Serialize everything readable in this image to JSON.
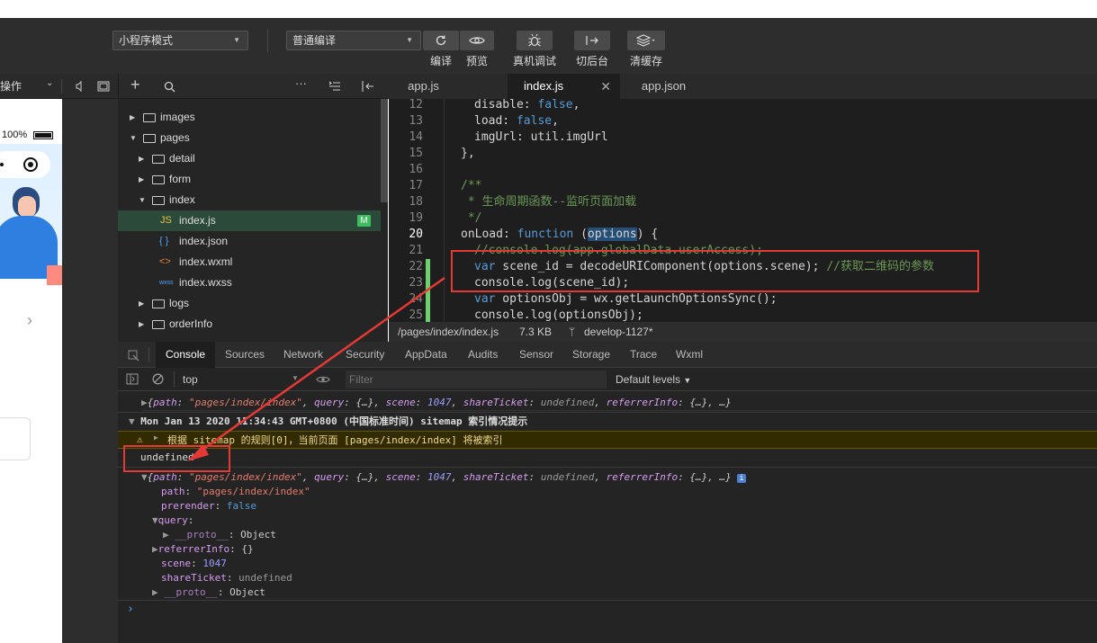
{
  "toolbar": {
    "mode_select": "小程序模式",
    "compile_select": "普通编译",
    "buttons": [
      {
        "label": "编译",
        "icon": "refresh-icon"
      },
      {
        "label": "预览",
        "icon": "eye-icon"
      },
      {
        "label": "真机调试",
        "icon": "bug-icon"
      },
      {
        "label": "切后台",
        "icon": "switch-icon"
      },
      {
        "label": "清缓存",
        "icon": "layers-icon"
      }
    ]
  },
  "sim_bar": {
    "label": "操作"
  },
  "simulator": {
    "battery": "100%"
  },
  "tree": {
    "items": [
      {
        "label": "images",
        "type": "folder",
        "depth": 0,
        "open": false
      },
      {
        "label": "pages",
        "type": "folder",
        "depth": 0,
        "open": true
      },
      {
        "label": "detail",
        "type": "folder",
        "depth": 1,
        "open": false
      },
      {
        "label": "form",
        "type": "folder",
        "depth": 1,
        "open": false
      },
      {
        "label": "index",
        "type": "folder",
        "depth": 1,
        "open": true
      },
      {
        "label": "index.js",
        "type": "js",
        "depth": 2,
        "badge": "M"
      },
      {
        "label": "index.json",
        "type": "json",
        "depth": 2
      },
      {
        "label": "index.wxml",
        "type": "wxml",
        "depth": 2
      },
      {
        "label": "index.wxss",
        "type": "wxss",
        "depth": 2
      },
      {
        "label": "logs",
        "type": "folder",
        "depth": 1,
        "open": false
      },
      {
        "label": "orderInfo",
        "type": "folder",
        "depth": 1,
        "open": false
      }
    ]
  },
  "editor_tabs": [
    {
      "label": "app.js"
    },
    {
      "label": "index.js"
    },
    {
      "label": "app.json"
    }
  ],
  "code": {
    "line_numbers": [
      "12",
      "13",
      "14",
      "15",
      "16",
      "17",
      "18",
      "19",
      "20",
      "21",
      "22",
      "23",
      "24",
      "25"
    ],
    "l12": [
      "disable: ",
      "false",
      ","
    ],
    "l13": [
      "load: ",
      "false",
      ","
    ],
    "l14": "imgUrl: util.imgUrl",
    "l15": "},",
    "l17": "/**",
    "l18": " * 生命周期函数--监听页面加载",
    "l19": " */",
    "l20": [
      "onLoad: ",
      "function",
      " (",
      "options",
      ") {"
    ],
    "l21": "//console.log(app.globalData.userAccess);",
    "l22": [
      "var",
      " scene_id = decodeURIComponent(options.scene); ",
      "//获取二维码的参数"
    ],
    "l23": "console.log(scene_id);",
    "l24": [
      "var",
      " optionsObj = wx.getLaunchOptionsSync();"
    ],
    "l25": "console.log(optionsObj);"
  },
  "status": {
    "path": "/pages/index/index.js",
    "size": "7.3 KB",
    "branch": "develop-1127*"
  },
  "devtools_tabs": [
    "Console",
    "Sources",
    "Network",
    "Security",
    "AppData",
    "Audits",
    "Sensor",
    "Storage",
    "Trace",
    "Wxml"
  ],
  "console_toolbar": {
    "context": "top",
    "filter_placeholder": "Filter",
    "levels": "Default levels"
  },
  "console": {
    "row1": [
      "{",
      "path",
      ": ",
      "\"pages/index/index\"",
      ", ",
      "query",
      ": {…}, ",
      "scene",
      ": ",
      "1047",
      ", ",
      "shareTicket",
      ": ",
      "undefined",
      ", ",
      "referrerInfo",
      ": {…}, …}"
    ],
    "row2": "Mon Jan 13 2020 11:34:43 GMT+0800 (中国标准时间) sitemap 索引情况提示",
    "row3": "根据 sitemap 的规则[0]，当前页面 [pages/index/index] 将被索引",
    "row4": "undefined",
    "row5": [
      "{",
      "path",
      ": ",
      "\"pages/index/index\"",
      ", ",
      "query",
      ": {…}, ",
      "scene",
      ": ",
      "1047",
      ", ",
      "shareTicket",
      ": ",
      "undefined",
      ", ",
      "referrerInfo",
      ": {…}, …}"
    ],
    "path_key": "path",
    "path_val": "\"pages/index/index\"",
    "prerender_key": "prerender",
    "prerender_val": "false",
    "query_key": "query",
    "proto_key": "__proto__",
    "proto_val": "Object",
    "referrer_key": "referrerInfo",
    "referrer_val": "{}",
    "scene_key": "scene",
    "scene_val": "1047",
    "share_key": "shareTicket",
    "share_val": "undefined",
    "proto2_key": "__proto__",
    "proto2_val": "Object",
    "prompt": "›"
  },
  "colors": {
    "annotation": "#e53935",
    "modified_badge": "#3dbd5f"
  }
}
